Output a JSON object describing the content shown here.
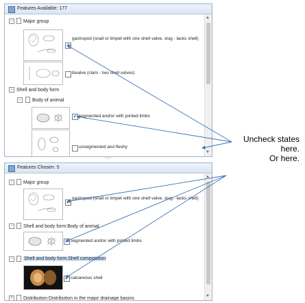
{
  "available_panel": {
    "header": "Features Available: 177",
    "groups": [
      {
        "label": "Major group"
      },
      {
        "label": "Shell and body form"
      },
      {
        "label": "Body of animal"
      }
    ],
    "options": [
      {
        "label": "gastropod (snail or limpet with one shell valve, slug - lacks shell)",
        "checked": true
      },
      {
        "label": "bivalve (clam - two shell valves)",
        "checked": false
      },
      {
        "label": "segmented and/or with jointed limbs",
        "checked": true
      },
      {
        "label": "unsegmented and fleshy",
        "checked": false
      }
    ]
  },
  "chosen_panel": {
    "header": "Features Chosen: 5",
    "groups": [
      {
        "label": "Major group"
      },
      {
        "label": "Shell and body form:Body of animal"
      },
      {
        "label": "Shell and body form:Shell composition"
      },
      {
        "label": "Distribution:Distribution in the major drainage basins"
      }
    ],
    "options": [
      {
        "label": "gastropod (snail or limpet with one shell valve, slug - lacks shell)",
        "checked": true
      },
      {
        "label": "segmented and/or with jointed limbs",
        "checked": true
      },
      {
        "label": "calcareous shell",
        "checked": true
      }
    ]
  },
  "callout": {
    "line1": "Uncheck states",
    "line2": "here.",
    "line3": "Or here."
  },
  "colors": {
    "arrow": "#3a6fb5",
    "check": "#1a3fbf",
    "highlight": "#cfe0f6"
  }
}
